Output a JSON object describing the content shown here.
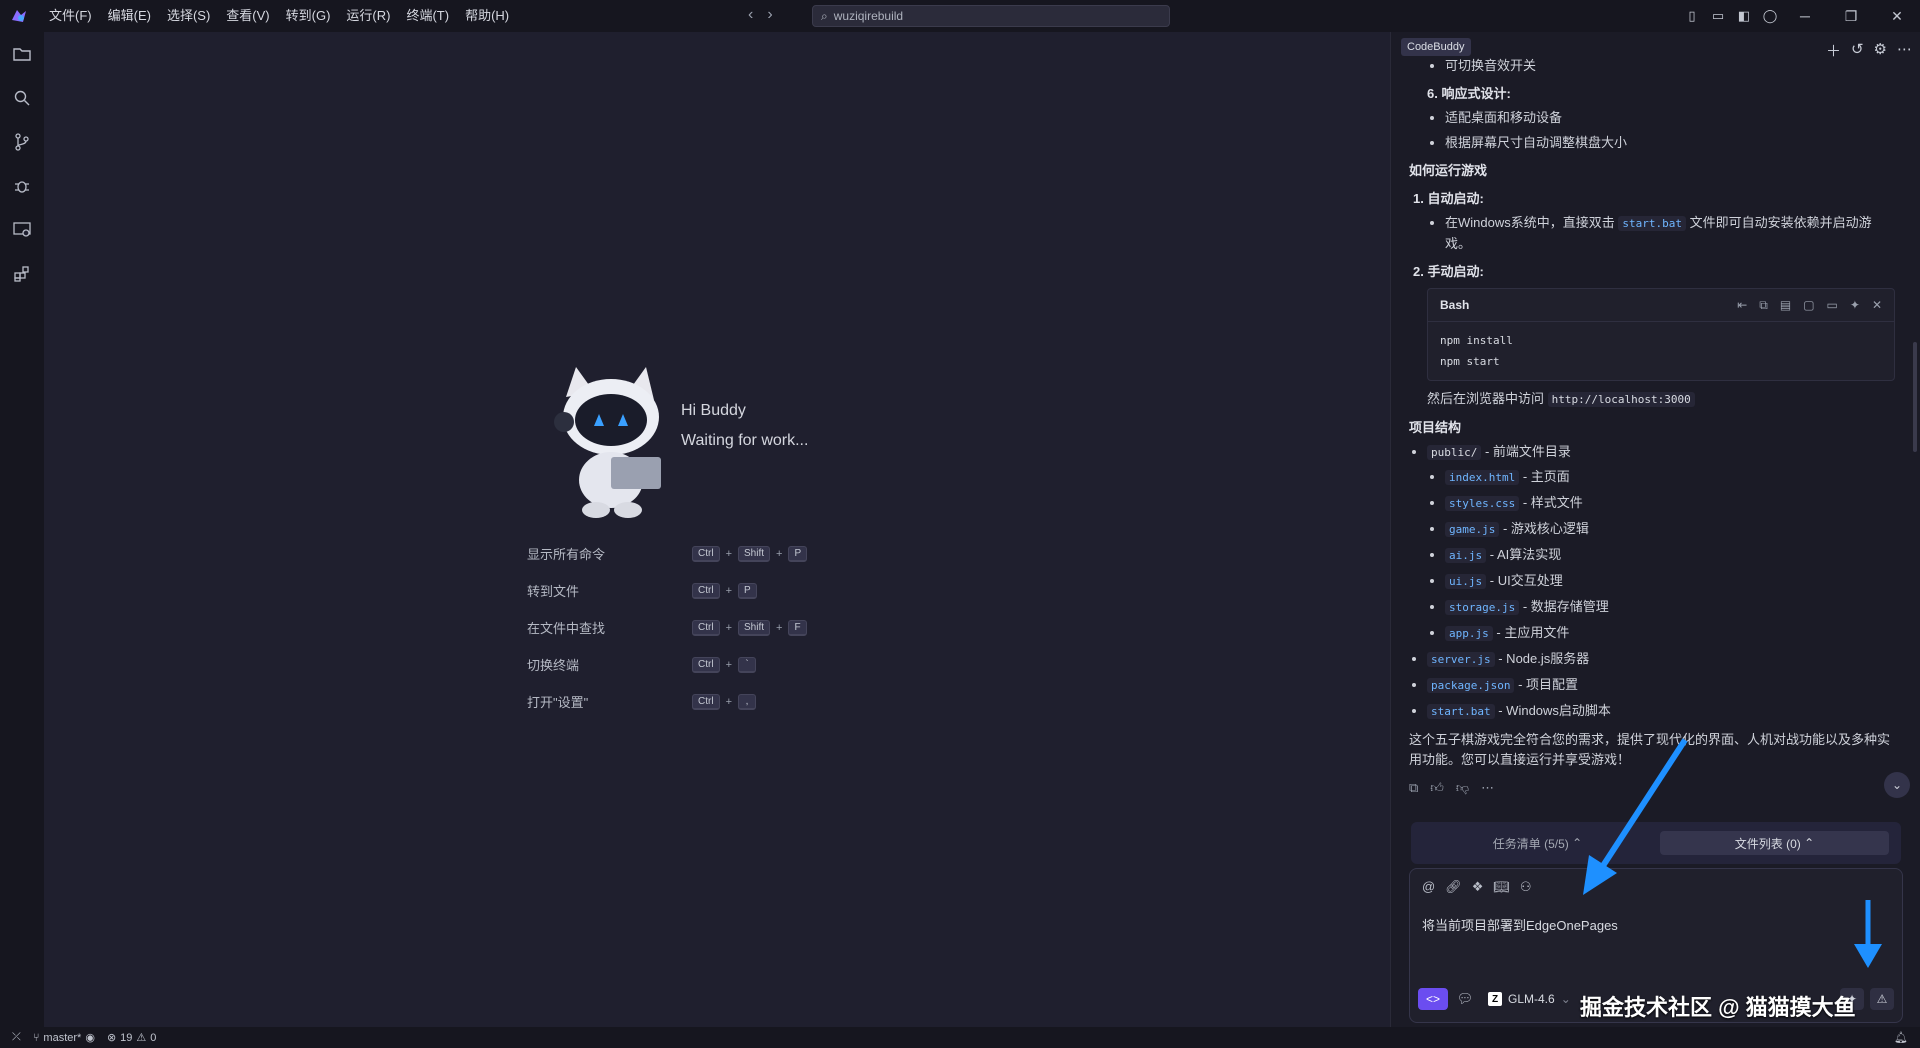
{
  "menu": [
    "文件(F)",
    "编辑(E)",
    "选择(S)",
    "查看(V)",
    "转到(G)",
    "运行(R)",
    "终端(T)",
    "帮助(H)"
  ],
  "search": {
    "value": "wuziqirebuild"
  },
  "welcome": {
    "greeting": "Hi Buddy",
    "status": "Waiting for work..."
  },
  "shortcuts": [
    {
      "label": "显示所有命令",
      "keys": [
        "Ctrl",
        "Shift",
        "P"
      ]
    },
    {
      "label": "转到文件",
      "keys": [
        "Ctrl",
        "P"
      ]
    },
    {
      "label": "在文件中查找",
      "keys": [
        "Ctrl",
        "Shift",
        "F"
      ]
    },
    {
      "label": "切换终端",
      "keys": [
        "Ctrl",
        "`"
      ]
    },
    {
      "label": "打开\"设置\"",
      "keys": [
        "Ctrl",
        ","
      ]
    }
  ],
  "panel": {
    "title": "CodeBuddy",
    "chat": {
      "top_item": "可切换音效开关",
      "responsive_title": "6. 响应式设计:",
      "responsive_items": [
        "适配桌面和移动设备",
        "根据屏幕尺寸自动调整棋盘大小"
      ],
      "how_title": "如何运行游戏",
      "auto_title": "1. 自动启动:",
      "auto_text_pre": "在Windows系统中，直接双击",
      "auto_code": "start.bat",
      "auto_text_post": "文件即可自动安装依赖并启动游戏。",
      "manual_title": "2. 手动启动:",
      "codeblock_lang": "Bash",
      "codeblock_lines": [
        "npm install",
        "npm start"
      ],
      "visit_text": "然后在浏览器中访问",
      "visit_url": "http://localhost:3000",
      "structure_title": "项目结构",
      "public_code": "public/",
      "public_desc": "- 前端文件目录",
      "public_files": [
        {
          "file": "index.html",
          "desc": "- 主页面"
        },
        {
          "file": "styles.css",
          "desc": "- 样式文件"
        },
        {
          "file": "game.js",
          "desc": "- 游戏核心逻辑"
        },
        {
          "file": "ai.js",
          "desc": "- AI算法实现"
        },
        {
          "file": "ui.js",
          "desc": "- UI交互处理"
        },
        {
          "file": "storage.js",
          "desc": "- 数据存储管理"
        },
        {
          "file": "app.js",
          "desc": "- 主应用文件"
        }
      ],
      "root_files": [
        {
          "file": "server.js",
          "desc": "- Node.js服务器"
        },
        {
          "file": "package.json",
          "desc": "- 项目配置"
        },
        {
          "file": "start.bat",
          "desc": "- Windows启动脚本"
        }
      ],
      "summary": "这个五子棋游戏完全符合您的需求，提供了现代化的界面、人机对战功能以及多种实用功能。您可以直接运行并享受游戏！"
    },
    "tabs": [
      {
        "label": "任务清单 (5/5)"
      },
      {
        "label": "文件列表 (0)"
      }
    ],
    "input": {
      "value": "将当前项目部署到EdgeOnePages"
    },
    "model": "GLM-4.6"
  },
  "status": {
    "branch": "master*",
    "errors": "19",
    "warnings": "0"
  },
  "watermark": "掘金技术社区 @ 猫猫摸大鱼",
  "colors": {
    "accent": "#6b4df0",
    "arrow": "#1e90ff",
    "code": "#6fb5ff"
  }
}
